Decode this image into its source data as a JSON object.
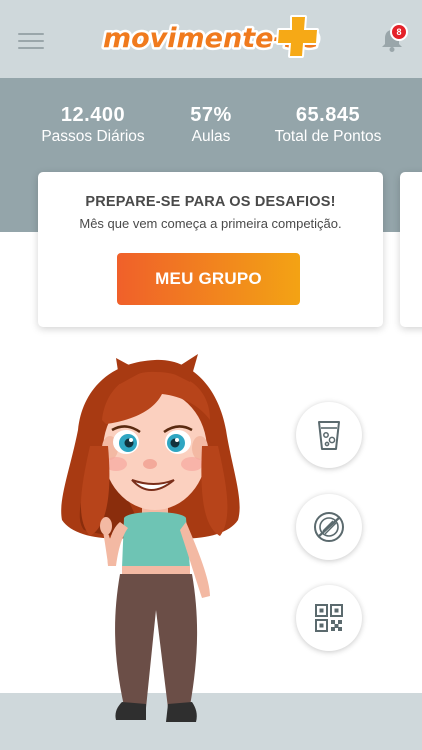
{
  "header": {
    "logo_text": "movimente-se",
    "menu_icon": "hamburger-menu-icon",
    "bell_icon": "bell-icon",
    "notification_count": "8"
  },
  "stats": [
    {
      "value": "12.400",
      "label": "Passos Diários"
    },
    {
      "value": "57%",
      "label": "Aulas"
    },
    {
      "value": "65.845",
      "label": "Total de Pontos"
    }
  ],
  "card": {
    "title": "PREPARE-SE PARA OS DESAFIOS!",
    "subtitle": "Mês que vem começa a primeira competição.",
    "button_label": "MEU GRUPO"
  },
  "actions": [
    {
      "icon": "water-glass-icon"
    },
    {
      "icon": "no-food-plate-icon"
    },
    {
      "icon": "qr-code-icon"
    }
  ],
  "colors": {
    "header_bg": "#cfd8db",
    "stats_bg": "#94a5aa",
    "accent_orange": "#f0602a",
    "accent_yellow": "#f3a314",
    "badge_red": "#e4222a"
  }
}
